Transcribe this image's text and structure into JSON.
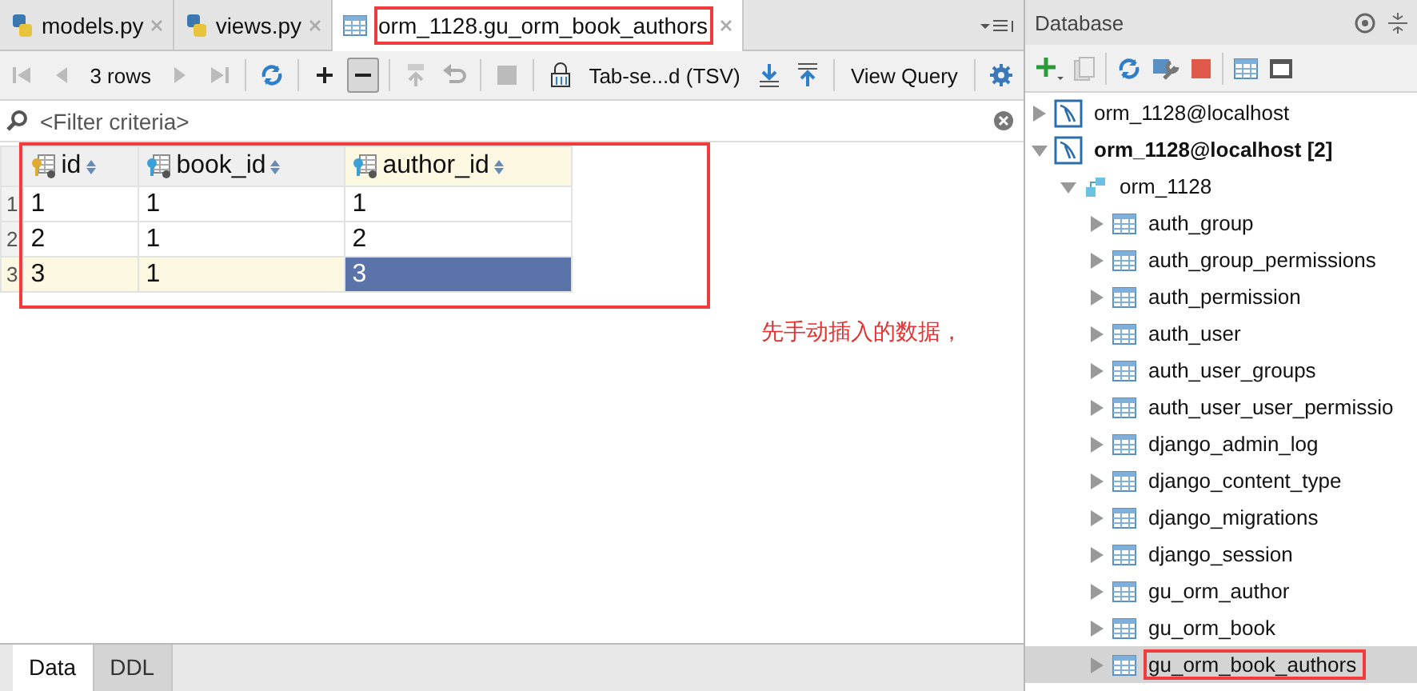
{
  "editor_tabs": [
    {
      "label": "models.py",
      "kind": "python",
      "selected": false
    },
    {
      "label": "views.py",
      "kind": "python",
      "selected": false
    },
    {
      "label": "orm_1128.gu_orm_book_authors",
      "kind": "table",
      "selected": true
    }
  ],
  "toolbar": {
    "rows_label": "3 rows",
    "navigation_disabled": true,
    "remove_pressed": true,
    "format": "Tab-se...d (TSV)",
    "view_query": "View Query"
  },
  "filter": {
    "placeholder": "<Filter criteria>"
  },
  "grid": {
    "columns": [
      {
        "name": "id",
        "selected": false
      },
      {
        "name": "book_id",
        "selected": false
      },
      {
        "name": "author_id",
        "selected": true
      }
    ],
    "rows": [
      {
        "number": "1",
        "current": false,
        "cells": [
          {
            "value": "1",
            "selected": false
          },
          {
            "value": "1",
            "selected": false
          },
          {
            "value": "1",
            "selected": false
          }
        ]
      },
      {
        "number": "2",
        "current": false,
        "cells": [
          {
            "value": "2",
            "selected": false
          },
          {
            "value": "1",
            "selected": false
          },
          {
            "value": "2",
            "selected": false
          }
        ]
      },
      {
        "number": "3",
        "current": true,
        "cells": [
          {
            "value": "3",
            "selected": false
          },
          {
            "value": "1",
            "selected": false
          },
          {
            "value": "3",
            "selected": true
          }
        ]
      }
    ]
  },
  "annotation": {
    "note": "先手动插入的数据，"
  },
  "bottom_tabs": [
    {
      "label": "Data",
      "selected": true
    },
    {
      "label": "DDL",
      "selected": false
    }
  ],
  "database": {
    "title": "Database",
    "tree": [
      {
        "label": "orm_1128@localhost",
        "kind": "datasource",
        "bold": false,
        "expanded": false,
        "selected": false
      },
      {
        "label": "orm_1128@localhost [2]",
        "kind": "datasource",
        "bold": true,
        "expanded": true,
        "selected": false,
        "children": [
          {
            "label": "orm_1128",
            "kind": "schema",
            "bold": false,
            "expanded": true,
            "selected": false,
            "children": [
              {
                "label": "auth_group",
                "kind": "table",
                "bold": false,
                "expanded": false,
                "selected": false
              },
              {
                "label": "auth_group_permissions",
                "kind": "table",
                "bold": false,
                "expanded": false,
                "selected": false
              },
              {
                "label": "auth_permission",
                "kind": "table",
                "bold": false,
                "expanded": false,
                "selected": false
              },
              {
                "label": "auth_user",
                "kind": "table",
                "bold": false,
                "expanded": false,
                "selected": false
              },
              {
                "label": "auth_user_groups",
                "kind": "table",
                "bold": false,
                "expanded": false,
                "selected": false
              },
              {
                "label": "auth_user_user_permissio",
                "kind": "table",
                "bold": false,
                "expanded": false,
                "selected": false
              },
              {
                "label": "django_admin_log",
                "kind": "table",
                "bold": false,
                "expanded": false,
                "selected": false
              },
              {
                "label": "django_content_type",
                "kind": "table",
                "bold": false,
                "expanded": false,
                "selected": false
              },
              {
                "label": "django_migrations",
                "kind": "table",
                "bold": false,
                "expanded": false,
                "selected": false
              },
              {
                "label": "django_session",
                "kind": "table",
                "bold": false,
                "expanded": false,
                "selected": false
              },
              {
                "label": "gu_orm_author",
                "kind": "table",
                "bold": false,
                "expanded": false,
                "selected": false
              },
              {
                "label": "gu_orm_book",
                "kind": "table",
                "bold": false,
                "expanded": false,
                "selected": false
              },
              {
                "label": "gu_orm_book_authors",
                "kind": "table",
                "bold": false,
                "expanded": false,
                "selected": true
              }
            ]
          }
        ]
      }
    ]
  }
}
